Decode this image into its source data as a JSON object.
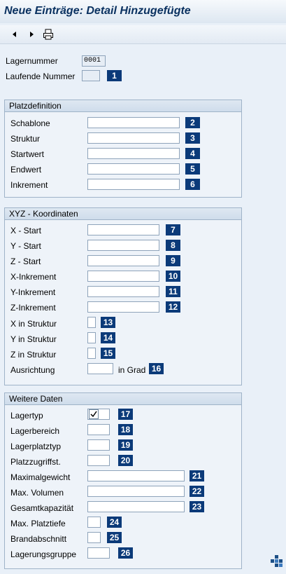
{
  "window": {
    "title": "Neue Einträge: Detail Hinzugefügte"
  },
  "toolbar": {
    "back": "previous-icon",
    "forward": "next-icon",
    "print": "print-icon"
  },
  "header": {
    "lagernummer_label": "Lagernummer",
    "lagernummer_value": "0001",
    "laufende_label": "Laufende Nummer",
    "laufende_value": "",
    "laufende_badge": "1"
  },
  "platzdefinition": {
    "title": "Platzdefinition",
    "fields": [
      {
        "label": "Schablone",
        "value": "",
        "badge": "2"
      },
      {
        "label": "Struktur",
        "value": "",
        "badge": "3"
      },
      {
        "label": "Startwert",
        "value": "",
        "badge": "4"
      },
      {
        "label": "Endwert",
        "value": "",
        "badge": "5"
      },
      {
        "label": "Inkrement",
        "value": "",
        "badge": "6"
      }
    ]
  },
  "xyz": {
    "title": "XYZ - Koordinaten",
    "fields": [
      {
        "label": "X - Start",
        "value": "",
        "badge": "7"
      },
      {
        "label": "Y - Start",
        "value": "",
        "badge": "8"
      },
      {
        "label": "Z - Start",
        "value": "",
        "badge": "9"
      },
      {
        "label": "X-Inkrement",
        "value": "",
        "badge": "10"
      },
      {
        "label": "Y-Inkrement",
        "value": "",
        "badge": "11"
      },
      {
        "label": "Z-Inkrement",
        "value": "",
        "badge": "12"
      },
      {
        "label": "X in Struktur",
        "value": "",
        "badge": "13"
      },
      {
        "label": "Y in Struktur",
        "value": "",
        "badge": "14"
      },
      {
        "label": "Z in Struktur",
        "value": "",
        "badge": "15"
      },
      {
        "label": "Ausrichtung",
        "value": "",
        "unit": "in Grad",
        "badge": "16"
      }
    ]
  },
  "weitere": {
    "title": "Weitere Daten",
    "fields": [
      {
        "label": "Lagertyp",
        "value": "",
        "badge": "17"
      },
      {
        "label": "Lagerbereich",
        "value": "",
        "badge": "18"
      },
      {
        "label": "Lagerplatztyp",
        "value": "",
        "badge": "19"
      },
      {
        "label": "Platzzugriffst.",
        "value": "",
        "badge": "20"
      },
      {
        "label": "Maximalgewicht",
        "value": "",
        "badge": "21"
      },
      {
        "label": "Max. Volumen",
        "value": "",
        "badge": "22"
      },
      {
        "label": "Gesamtkapazität",
        "value": "",
        "badge": "23"
      },
      {
        "label": "Max. Platztiefe",
        "value": "",
        "badge": "24"
      },
      {
        "label": "Brandabschnitt",
        "value": "",
        "badge": "25"
      },
      {
        "label": "Lagerungsgruppe",
        "value": "",
        "badge": "26"
      }
    ]
  },
  "statusbar": {
    "icon": "sap-logo-icon"
  }
}
